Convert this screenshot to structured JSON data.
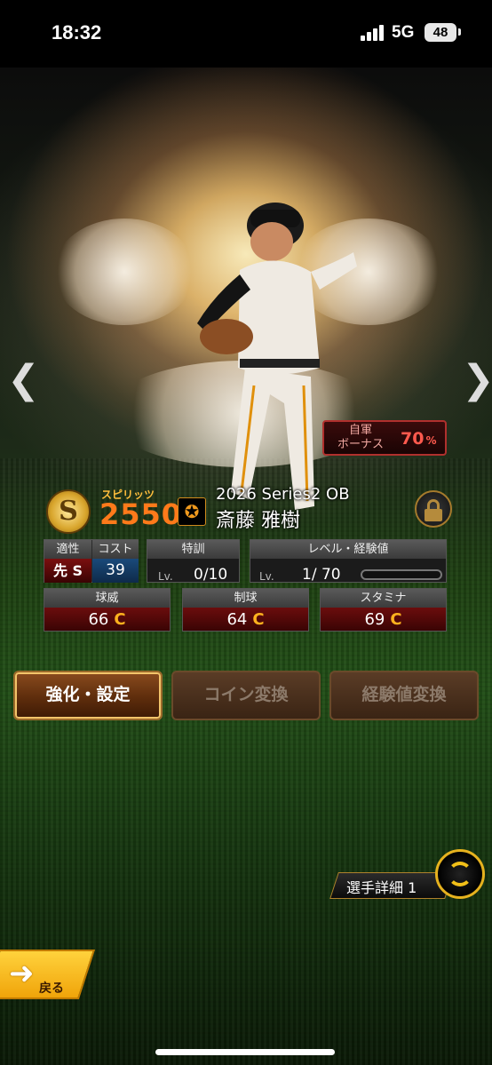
{
  "status_bar": {
    "time": "18:32",
    "network": "5G",
    "battery": "48"
  },
  "card": {
    "bonus_label": "自軍\nボーナス",
    "bonus_value": "70",
    "bonus_unit": "%",
    "spirits_label": "スピリッツ",
    "spirits_value": "2550",
    "series": "2026 Series2 OB",
    "name": "斎藤 雅樹"
  },
  "stats": {
    "aptitude_label": "適性",
    "aptitude_value": "先 S",
    "cost_label": "コスト",
    "cost_value": "39",
    "training_label": "特訓",
    "training_prefix": "Lv.",
    "training_value": "0/10",
    "level_label": "レベル・経験値",
    "level_prefix": "Lv.",
    "level_value": "1/ 70",
    "level_progress": 0.0,
    "ability": [
      {
        "label": "球威",
        "value": "66",
        "grade": "C"
      },
      {
        "label": "制球",
        "value": "64",
        "grade": "C"
      },
      {
        "label": "スタミナ",
        "value": "69",
        "grade": "C"
      }
    ]
  },
  "buttons": {
    "enhance": "強化・設定",
    "coin": "コイン変換",
    "exp": "経験値変換"
  },
  "detail": {
    "label": "選手詳細 1"
  },
  "back": {
    "label": "戻る"
  },
  "colors": {
    "accent_gold": "#f2c018",
    "stat_red": "#6b0d0d",
    "spirits_orange": "#ff7a1a"
  }
}
